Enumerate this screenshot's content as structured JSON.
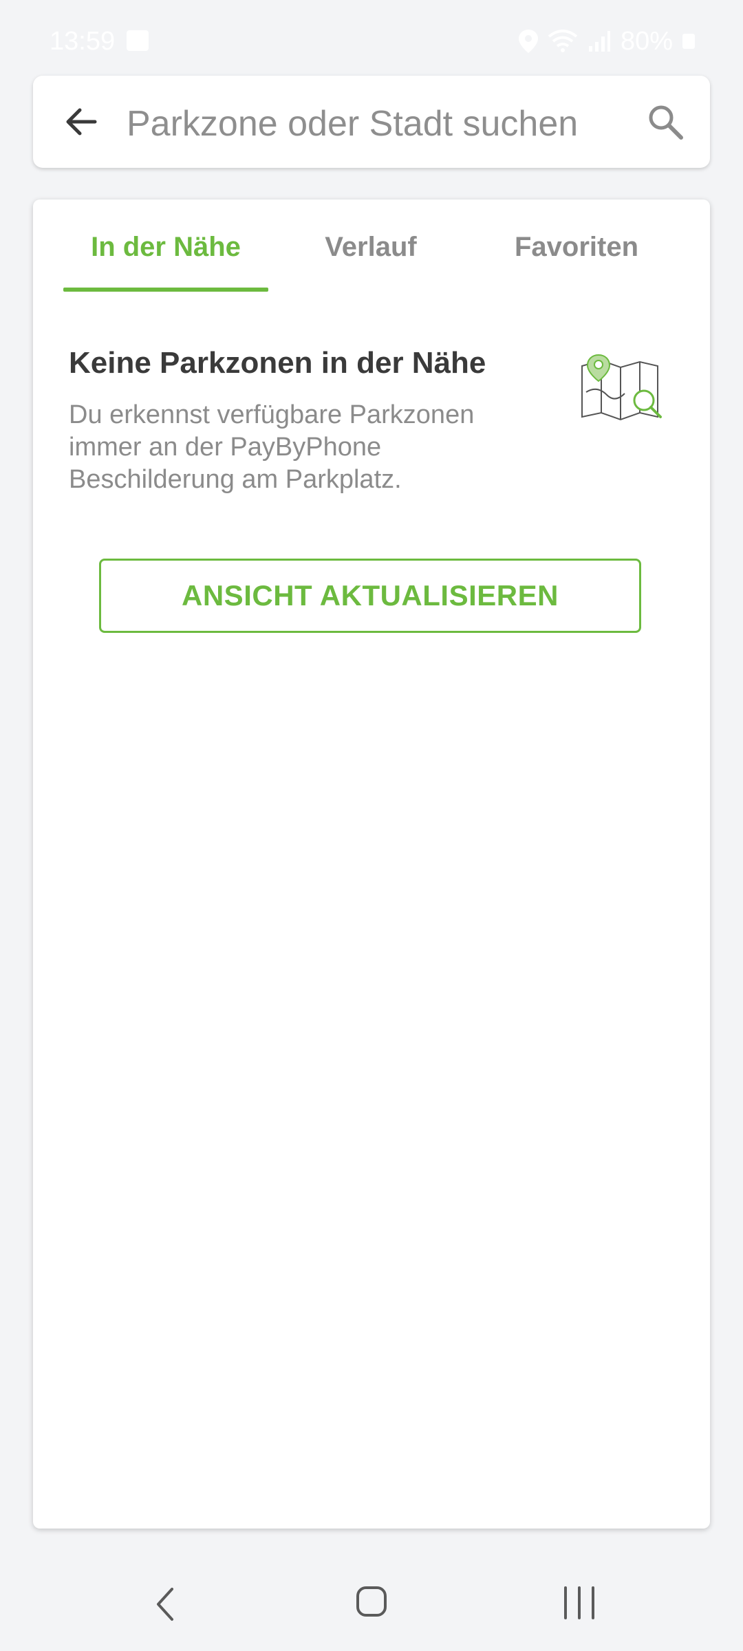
{
  "status_bar": {
    "time": "13:59",
    "battery": "80%"
  },
  "search": {
    "placeholder": "Parkzone oder Stadt suchen"
  },
  "tabs": [
    {
      "label": "In der Nähe",
      "active": true
    },
    {
      "label": "Verlauf",
      "active": false
    },
    {
      "label": "Favoriten",
      "active": false
    }
  ],
  "empty_state": {
    "title": "Keine Parkzonen in der Nähe",
    "description": "Du erkennst verfügbare Parkzonen immer an der PayByPhone Beschilderung am Parkplatz.",
    "button_label": "ANSICHT AKTUALISIEREN"
  },
  "colors": {
    "accent": "#6cba3f",
    "text_dark": "#3a3a3a",
    "text_muted": "#8b8b8b",
    "background": "#f3f4f6"
  },
  "icons": [
    "gallery-icon",
    "location-icon",
    "wifi-icon",
    "signal-icon",
    "battery-icon",
    "back-arrow-icon",
    "search-icon",
    "map-search-icon",
    "nav-back-icon",
    "nav-home-icon",
    "nav-recents-icon"
  ]
}
